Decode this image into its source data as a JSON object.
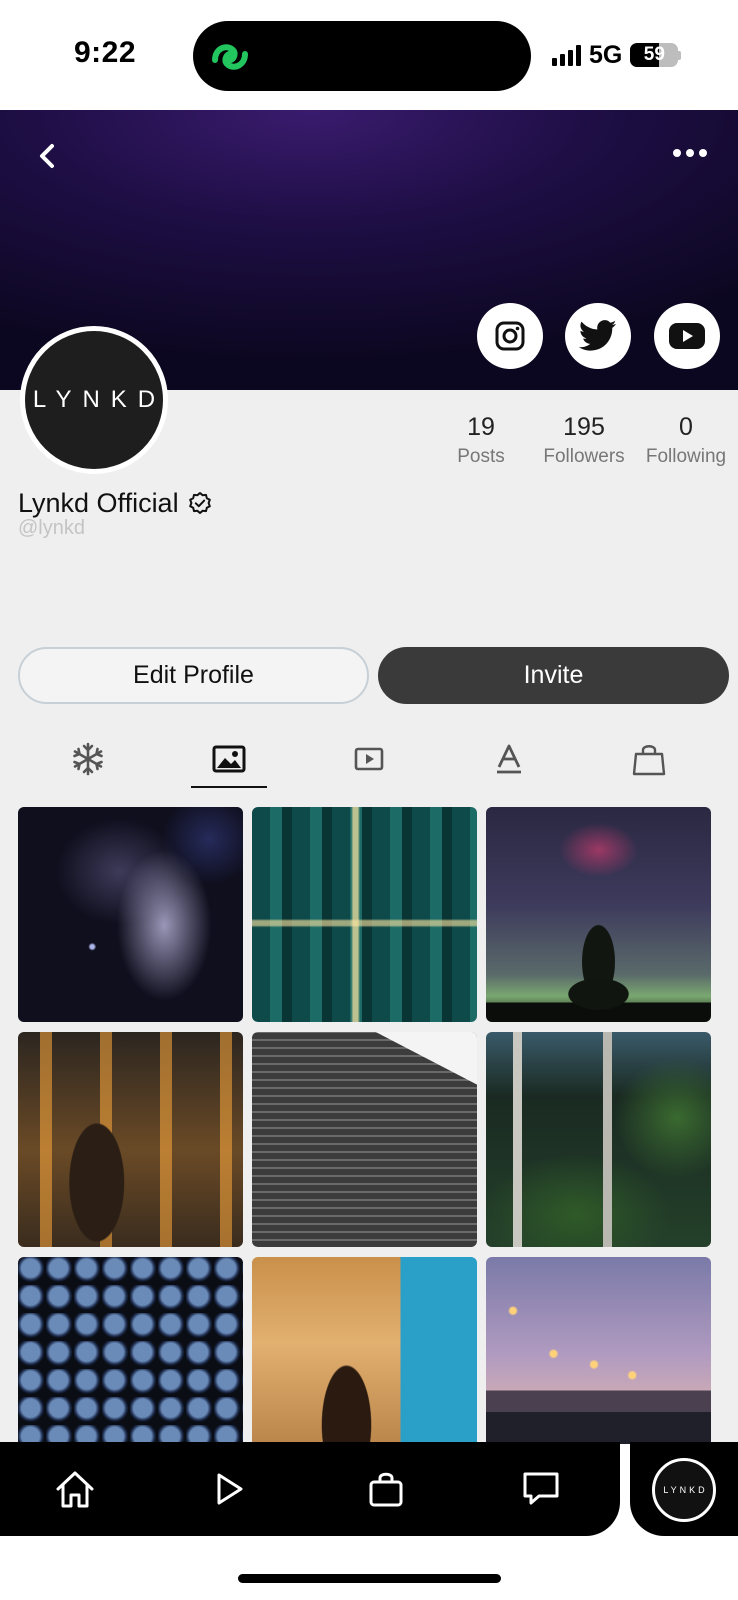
{
  "status_bar": {
    "time": "9:22",
    "network": "5G",
    "battery": "59",
    "battery_level": 0.59,
    "island_app_color": "#22c55e"
  },
  "header": {
    "back_icon": "chevron-left-icon",
    "more_icon": "more-horizontal-icon",
    "social_links": [
      "instagram-icon",
      "twitter-icon",
      "youtube-icon"
    ]
  },
  "profile": {
    "avatar_text": "LYNKD",
    "name": "Lynkd Official",
    "handle": "@lynkd",
    "verified": true,
    "stats": {
      "posts": {
        "value": "19",
        "label": "Posts"
      },
      "followers": {
        "value": "195",
        "label": "Followers"
      },
      "following": {
        "value": "0",
        "label": "Following"
      }
    }
  },
  "actions": {
    "edit_label": "Edit Profile",
    "invite_label": "Invite"
  },
  "tabs": {
    "items": [
      "snowflake-icon",
      "image-icon",
      "video-icon",
      "text-icon",
      "shopping-bag-icon"
    ],
    "active": "image-icon"
  },
  "grid": {
    "items": [
      "space-nebula",
      "city-aerial",
      "milky-way-tree",
      "arch-colonnade",
      "apartment-building",
      "green-terraces",
      "blue-spheres",
      "arc-de-triomphe",
      "bridge-sunset"
    ]
  },
  "bottom_nav": {
    "items": [
      "home-icon",
      "play-icon",
      "shopping-bag-icon",
      "chat-icon"
    ],
    "avatar_text": "LYNKD"
  }
}
